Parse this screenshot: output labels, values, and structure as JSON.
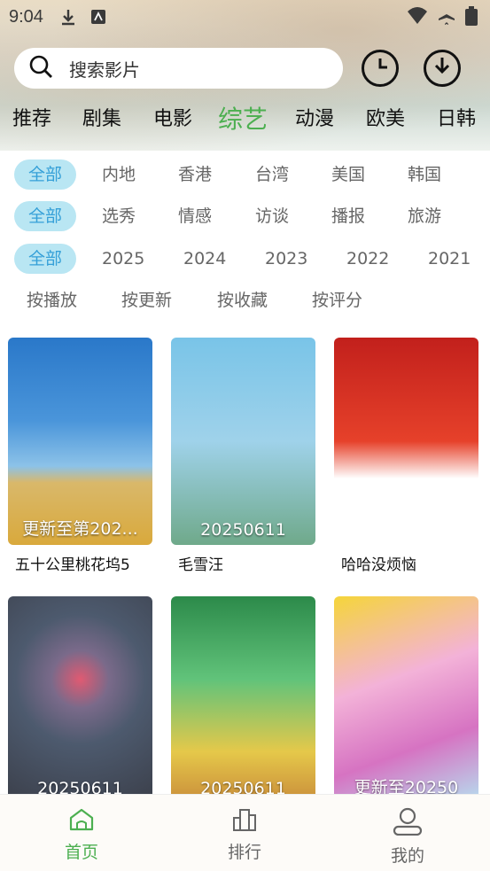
{
  "status_bar": {
    "time": "9:04"
  },
  "search": {
    "placeholder": "搜索影片"
  },
  "categories": [
    "推荐",
    "剧集",
    "电影",
    "综艺",
    "动漫",
    "欧美",
    "日韩"
  ],
  "active_category": "综艺",
  "filters": {
    "region": [
      "全部",
      "内地",
      "香港",
      "台湾",
      "美国",
      "韩国"
    ],
    "genre": [
      "全部",
      "选秀",
      "情感",
      "访谈",
      "播报",
      "旅游"
    ],
    "year": [
      "全部",
      "2025",
      "2024",
      "2023",
      "2022",
      "2021"
    ],
    "sort": [
      "按播放",
      "按更新",
      "按收藏",
      "按评分"
    ]
  },
  "cards": [
    {
      "title": "五十公里桃花坞5",
      "tag": "更新至第202..."
    },
    {
      "title": "毛雪汪",
      "tag": "20250611"
    },
    {
      "title": "哈哈没烦恼",
      "tag": ""
    },
    {
      "title": "",
      "tag": "20250611"
    },
    {
      "title": "",
      "tag": "20250611"
    },
    {
      "title": "",
      "tag": "更新至20250"
    }
  ],
  "bottom_nav": [
    {
      "label": "首页",
      "icon": "home-icon"
    },
    {
      "label": "排行",
      "icon": "rank-icon"
    },
    {
      "label": "我的",
      "icon": "profile-icon"
    }
  ],
  "colors": {
    "accent_green": "#4caf50",
    "chip_bg": "#b9e6f3",
    "chip_text": "#35a0d8"
  }
}
